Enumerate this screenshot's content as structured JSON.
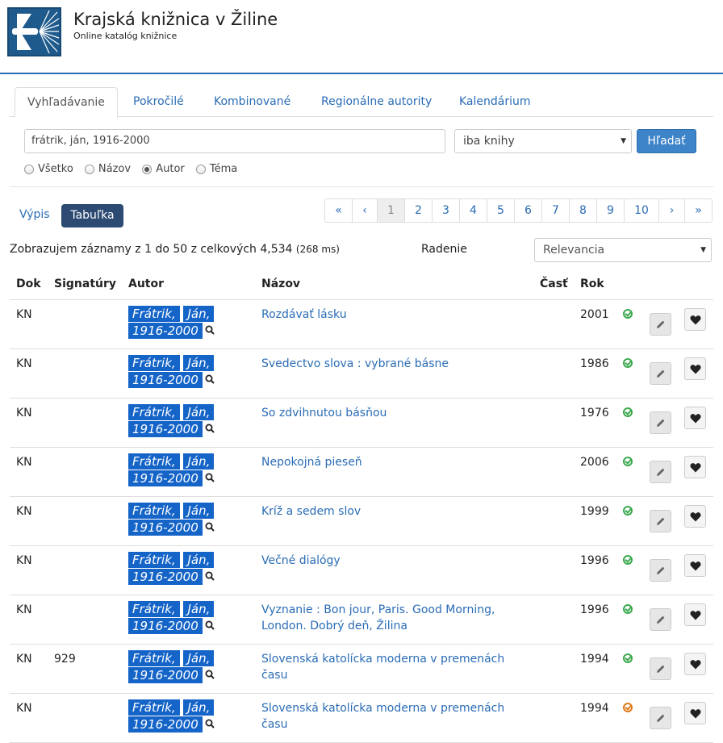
{
  "header": {
    "title": "Krajská knižnica v Žiline",
    "subtitle": "Online katalóg knižnice"
  },
  "tabs": [
    {
      "label": "Vyhľadávanie",
      "active": true
    },
    {
      "label": "Pokročilé"
    },
    {
      "label": "Kombinované"
    },
    {
      "label": "Regionálne autority"
    },
    {
      "label": "Kalendárium"
    }
  ],
  "search": {
    "query": "frátrik, ján, 1916-2000",
    "type_selected": "iba knihy",
    "button": "Hľadať"
  },
  "radios": [
    {
      "label": "Všetko",
      "checked": false
    },
    {
      "label": "Názov",
      "checked": false
    },
    {
      "label": "Autor",
      "checked": true
    },
    {
      "label": "Téma",
      "checked": false
    }
  ],
  "view": {
    "list": "Výpis",
    "table": "Tabuľka"
  },
  "pager": [
    "«",
    "‹",
    "1",
    "2",
    "3",
    "4",
    "5",
    "6",
    "7",
    "8",
    "9",
    "10",
    "›",
    "»"
  ],
  "summary": {
    "text": "Zobrazujem záznamy z 1 do 50 z celkových 4,534",
    "time": "(268 ms)"
  },
  "sort": {
    "label": "Radenie",
    "selected": "Relevancia"
  },
  "table": {
    "headers": [
      "Dok",
      "Signatúry",
      "Autor",
      "Názov",
      "Časť",
      "Rok"
    ],
    "rows": [
      {
        "dok": "KN",
        "sig": "",
        "author1": "Frátrik,",
        "author2": "Ján,",
        "author3": "1916-2000",
        "title": "Rozdávať lásku",
        "year": "2001",
        "status": "green"
      },
      {
        "dok": "KN",
        "sig": "",
        "author1": "Frátrik,",
        "author2": "Ján,",
        "author3": "1916-2000",
        "title": "Svedectvo slova : vybrané básne",
        "year": "1986",
        "status": "green"
      },
      {
        "dok": "KN",
        "sig": "",
        "author1": "Frátrik,",
        "author2": "Ján,",
        "author3": "1916-2000",
        "title": "So zdvihnutou básňou",
        "year": "1976",
        "status": "green"
      },
      {
        "dok": "KN",
        "sig": "",
        "author1": "Frátrik,",
        "author2": "Ján,",
        "author3": "1916-2000",
        "title": "Nepokojná pieseň",
        "year": "2006",
        "status": "green"
      },
      {
        "dok": "KN",
        "sig": "",
        "author1": "Frátrik,",
        "author2": "Ján,",
        "author3": "1916-2000",
        "title": "Kríž a sedem slov",
        "year": "1999",
        "status": "green"
      },
      {
        "dok": "KN",
        "sig": "",
        "author1": "Frátrik,",
        "author2": "Ján,",
        "author3": "1916-2000",
        "title": "Večné dialógy",
        "year": "1996",
        "status": "green"
      },
      {
        "dok": "KN",
        "sig": "",
        "author1": "Frátrik,",
        "author2": "Ján,",
        "author3": "1916-2000",
        "title": "Vyznanie : Bon jour, Paris. Good Morning, London. Dobrý deň, Žilina",
        "year": "1996",
        "status": "green"
      },
      {
        "dok": "KN",
        "sig": "929",
        "author1": "Frátrik,",
        "author2": "Ján,",
        "author3": "1916-2000",
        "title": "Slovenská katolícka moderna v premenách času",
        "year": "1994",
        "status": "green"
      },
      {
        "dok": "KN",
        "sig": "",
        "author1": "Frátrik,",
        "author2": "Ján,",
        "author3": "1916-2000",
        "title": "Slovenská katolícka moderna v premenách času",
        "year": "1994",
        "status": "orange"
      }
    ]
  },
  "icons": {
    "search": "magnifier-icon",
    "edit": "pencil-icon",
    "favorite": "heart-icon",
    "status": "check-circle-icon"
  }
}
